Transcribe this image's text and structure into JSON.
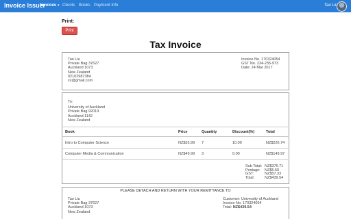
{
  "navbar": {
    "brand": "Invoice Issuer",
    "items": [
      {
        "label": "Invoices",
        "active": true
      },
      {
        "label": "Clients",
        "active": false
      },
      {
        "label": "Books",
        "active": false
      },
      {
        "label": "Payment Info",
        "active": false
      }
    ],
    "caret": "▾",
    "user_name": "Tao Liu"
  },
  "print": {
    "heading": "Print:",
    "button_label": "Print"
  },
  "invoice": {
    "title": "Tax Invoice",
    "issuer": {
      "lines": [
        "Tao Liu",
        "Private Bag 37627",
        "Auckland 1073",
        "New Zealand",
        "02102987384",
        "xx@gmail.com"
      ]
    },
    "meta": {
      "lines": [
        "Invoice No. 170324054",
        "GST No. 234-235-973",
        "Date: 24 Mar 2017"
      ]
    },
    "to": {
      "label": "To:",
      "lines": [
        "University of Auckland",
        "Private Bag 92019",
        "Auckland 1142",
        "New Zealand"
      ]
    },
    "table": {
      "headers": [
        "Book",
        "Price",
        "Quantity",
        "Discount(%)",
        "Total"
      ],
      "rows": [
        [
          "Intro to Computer Science",
          "NZ$35.99",
          "7",
          "10.00",
          "NZ$226.74"
        ],
        [
          "Computer Media & Communication",
          "NZ$49.99",
          "3",
          "0.00",
          "NZ$149.97"
        ]
      ]
    },
    "totals": {
      "labels": [
        "Sub Total:",
        "Postage:",
        "GST:",
        "Total:"
      ],
      "values": [
        "NZ$376.71",
        "NZ$5.50",
        "NZ$57.33",
        "NZ$439.54"
      ]
    },
    "remittance": {
      "heading": "PLEASE DETACH AND RETURN WITH YOUR REMITTANCE TO",
      "lines": [
        "Tao Liu",
        "Private Bag 37627",
        "Auckland 1073",
        "New Zealand"
      ],
      "customer": "Customer: University of Auckland",
      "invoice_no": "Invoice No. 170324054",
      "total_label": "Total:",
      "total_value": "NZ$439.54"
    }
  }
}
